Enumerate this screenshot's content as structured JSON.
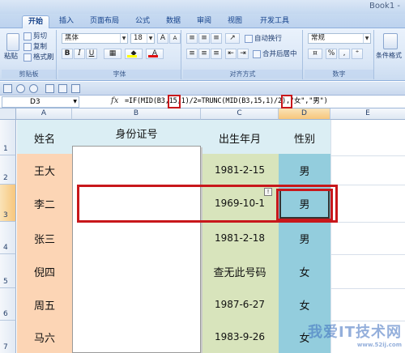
{
  "window": {
    "title": "Book1 -"
  },
  "tabs": [
    "开始",
    "插入",
    "页面布局",
    "公式",
    "数据",
    "审阅",
    "视图",
    "开发工具"
  ],
  "ribbon": {
    "clipboard": {
      "paste": "粘贴",
      "cut": "剪切",
      "copy": "复制",
      "format_painter": "格式刷",
      "label": "剪贴板"
    },
    "font": {
      "name": "黑体",
      "size": "18",
      "label": "字体",
      "bold": "B",
      "italic": "I",
      "underline": "U",
      "grow": "A",
      "shrink": "A",
      "fill_color": "#ffff00",
      "font_color": "#e01010"
    },
    "alignment": {
      "wrap": "自动换行",
      "merge": "合并后居中",
      "label": "对齐方式"
    },
    "number": {
      "format": "常规",
      "percent": "%",
      "comma": ",",
      "label": "数字"
    },
    "styles": {
      "cond": "条件格式"
    }
  },
  "formula_bar": {
    "name_box": "D3",
    "fx": "fx",
    "formula": "=IF(MID(B3,15,1)/2=TRUNC(MID(B3,15,1)/2),\"女\",\"男\")"
  },
  "grid": {
    "columns": [
      "A",
      "B",
      "C",
      "D",
      "E"
    ],
    "rows": [
      "1",
      "2",
      "3",
      "4",
      "5",
      "6",
      "7"
    ],
    "header": {
      "name": "姓名",
      "id": "身份证号",
      "birth": "出生年月",
      "gender": "性别"
    },
    "data": [
      {
        "name": "王大",
        "birth": "1981-2-15",
        "gender": "男"
      },
      {
        "name": "李二",
        "birth": "1969-10-1",
        "gender": "男"
      },
      {
        "name": "张三",
        "birth": "1981-2-18",
        "gender": "男"
      },
      {
        "name": "倪四",
        "birth": "查无此号码",
        "gender": "女"
      },
      {
        "name": "周五",
        "birth": "1987-6-27",
        "gender": "女"
      },
      {
        "name": "马六",
        "birth": "1983-9-26",
        "gender": "女"
      }
    ],
    "colors": {
      "name_col": "#fcd5b5",
      "header_row": "#dbeef4",
      "birth_col": "#d8e4bc",
      "gender_col": "#93cddd",
      "highlight": "#c8171b"
    }
  },
  "watermark": {
    "main": "我爱IT技术网",
    "sub": "www.52ij.com"
  }
}
